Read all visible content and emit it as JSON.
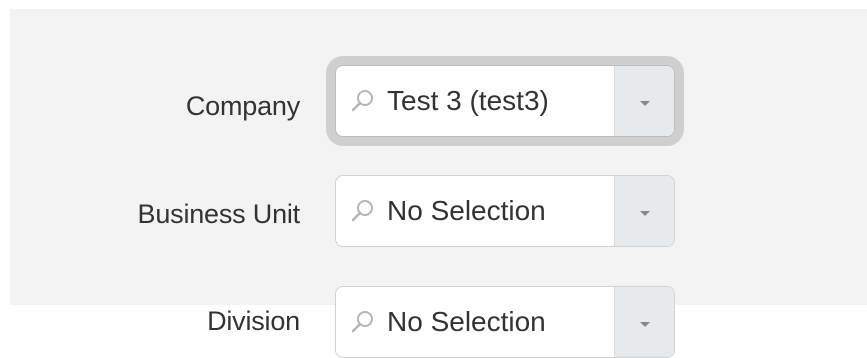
{
  "form": {
    "fields": [
      {
        "label": "Company",
        "value": "Test 3 (test3)",
        "search_icon": "search-icon",
        "dropdown_icon": "chevron-down-icon",
        "focused": true
      },
      {
        "label": "Business Unit",
        "value": "No Selection",
        "search_icon": "search-icon",
        "dropdown_icon": "chevron-down-icon",
        "focused": false
      },
      {
        "label": "Division",
        "value": "No Selection",
        "search_icon": "search-icon",
        "dropdown_icon": "chevron-down-icon",
        "focused": false
      }
    ]
  },
  "colors": {
    "panel_background": "#f3f3f3",
    "focus_ring": "#cfcfcf",
    "toggle_background": "#e7eaed",
    "text": "#333333"
  }
}
